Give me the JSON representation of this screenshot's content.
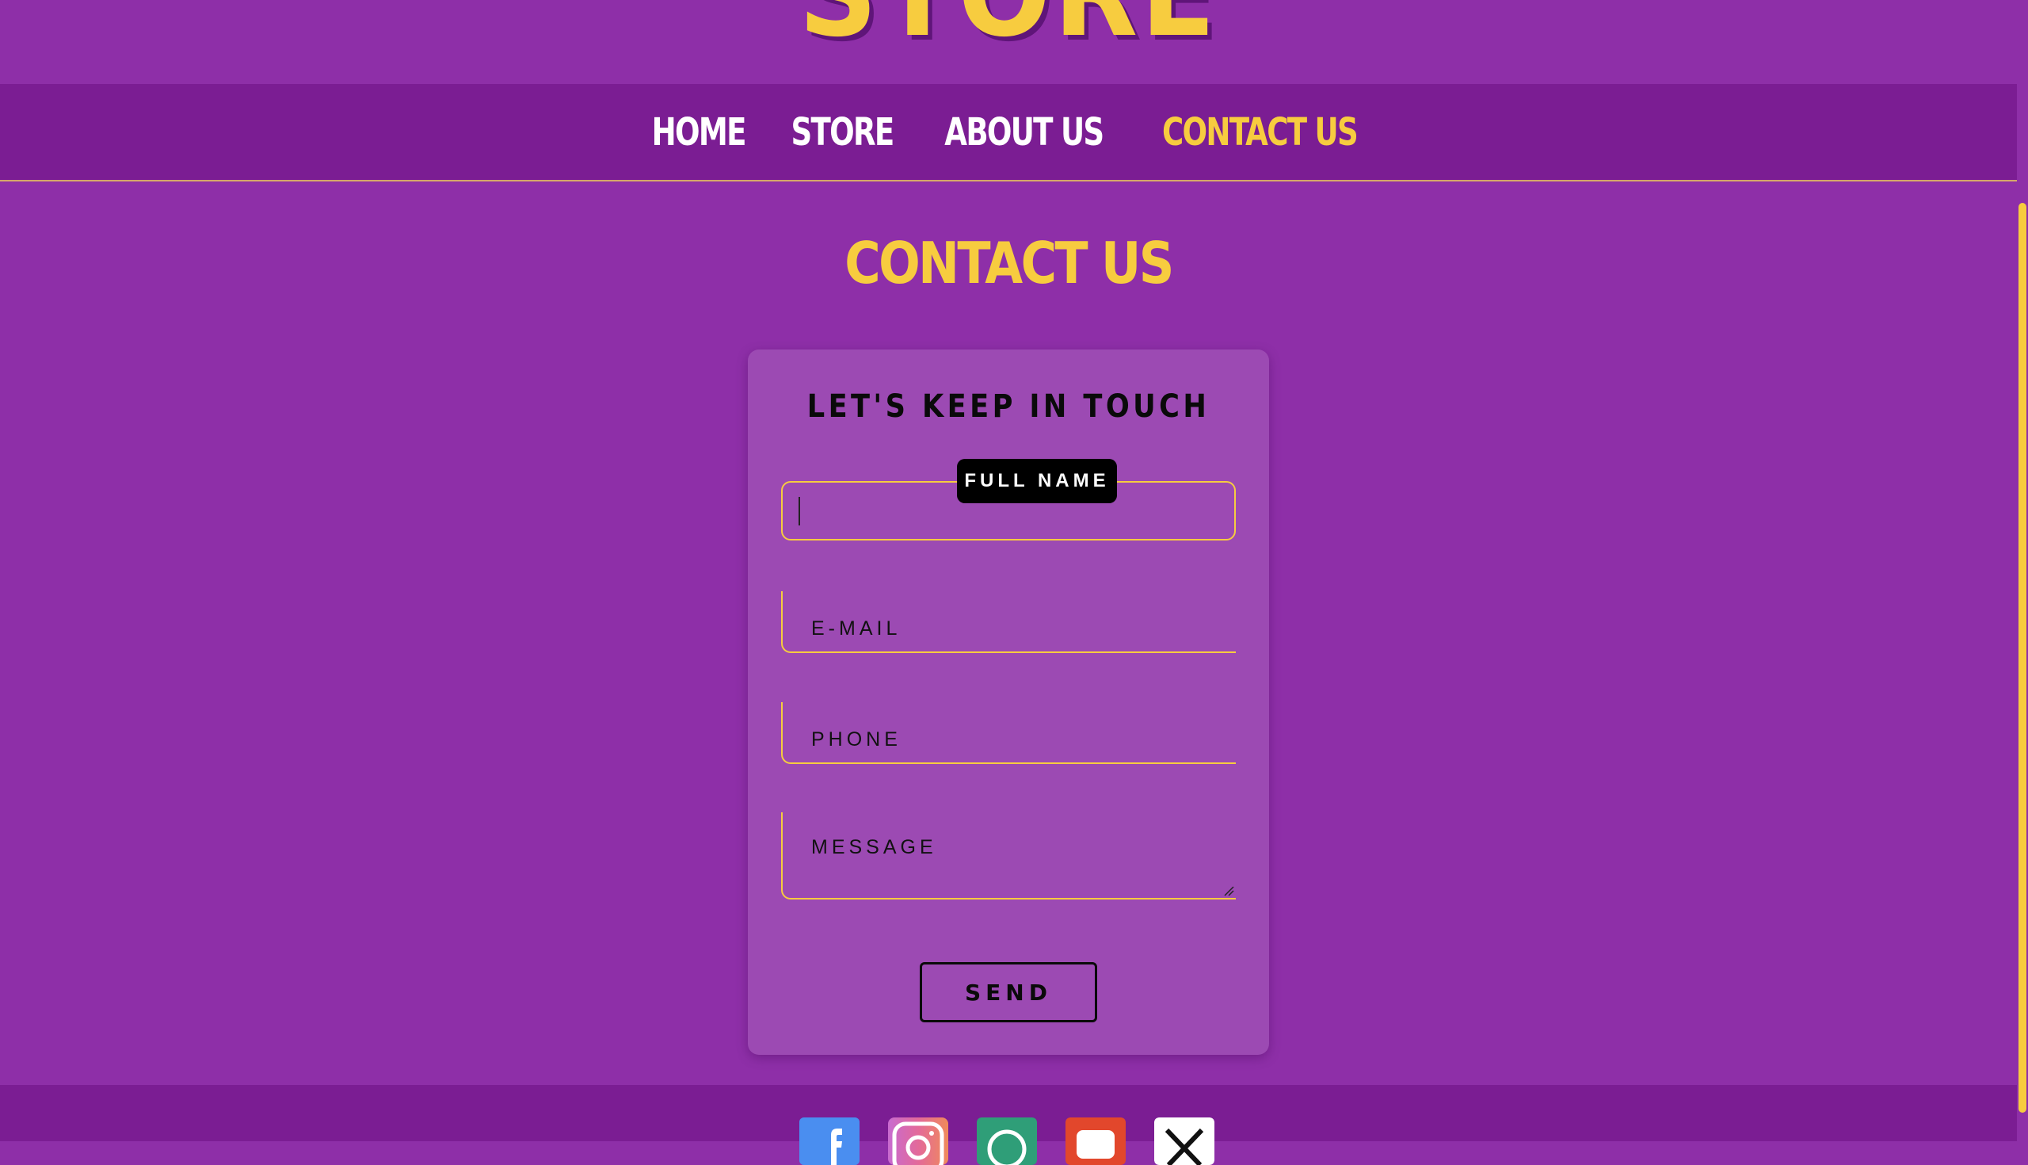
{
  "brand": {
    "logo_text": "STORE"
  },
  "nav": {
    "items": [
      {
        "label": "HOME",
        "active": false
      },
      {
        "label": "STORE",
        "active": false
      },
      {
        "label": "ABOUT US",
        "active": false
      },
      {
        "label": "CONTACT US",
        "active": true
      }
    ]
  },
  "page": {
    "title": "CONTACT US"
  },
  "form": {
    "title": "LET'S KEEP IN TOUCH",
    "full_name_label": "FULL NAME",
    "full_name_value": "",
    "email_label": "E-MAIL",
    "phone_label": "PHONE",
    "message_label": "MESSAGE",
    "send_label": "SEND"
  },
  "footer": {
    "social_icons": [
      "facebook-icon",
      "instagram-icon",
      "whatsapp-icon",
      "youtube-icon",
      "x-icon"
    ]
  },
  "colors": {
    "background": "#8e2fa8",
    "navbar": "#7b1d93",
    "accent": "#f7cc3f",
    "card": "#9c4ab3"
  }
}
